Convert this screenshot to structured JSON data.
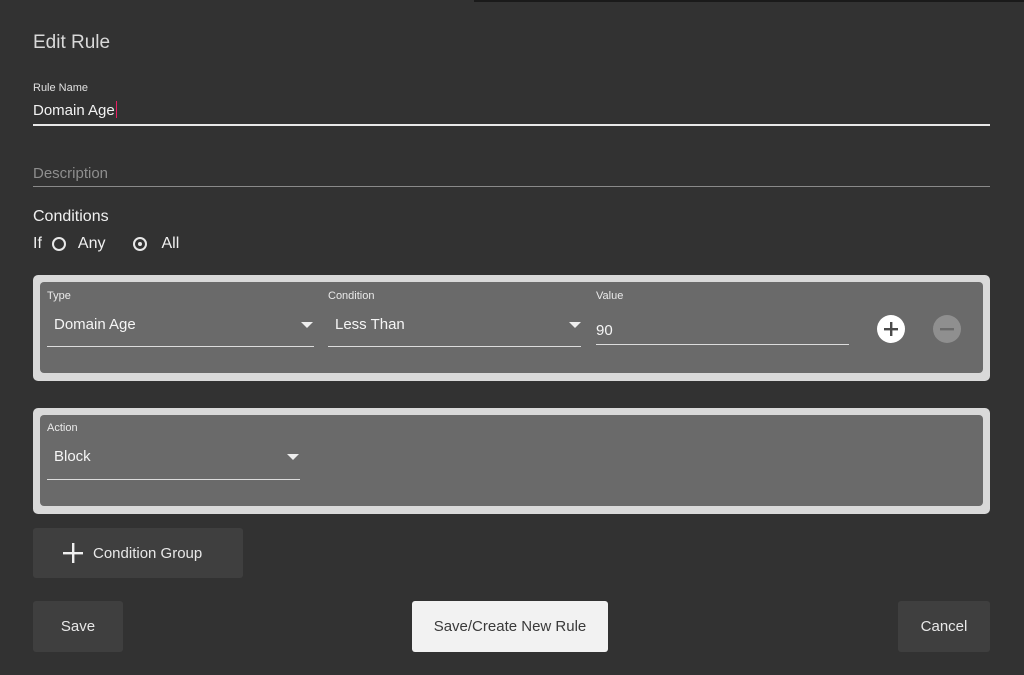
{
  "dialog": {
    "title": "Edit Rule"
  },
  "rule_name": {
    "label": "Rule Name",
    "value": "Domain Age"
  },
  "description": {
    "placeholder": "Description"
  },
  "conditions": {
    "title": "Conditions",
    "if_label": "If",
    "options": [
      "Any",
      "All"
    ],
    "selected": "All"
  },
  "condition_row": {
    "type_label": "Type",
    "type_value": "Domain Age",
    "condition_label": "Condition",
    "condition_value": "Less Than",
    "value_label": "Value",
    "value": "90"
  },
  "action": {
    "label": "Action",
    "value": "Block"
  },
  "buttons": {
    "condition_group": "Condition Group",
    "save": "Save",
    "save_create": "Save/Create New Rule",
    "cancel": "Cancel"
  },
  "icons": {
    "add": "plus-circle-icon",
    "remove": "minus-circle-icon",
    "dropdown": "caret-down-icon",
    "add_group": "plus-icon"
  },
  "colors": {
    "dialog_bg": "#323232",
    "group_border": "#d9d9d9",
    "group_bg": "#6a6a6a",
    "caret": "#e91e63",
    "primary_button": "#f2f2f2"
  }
}
